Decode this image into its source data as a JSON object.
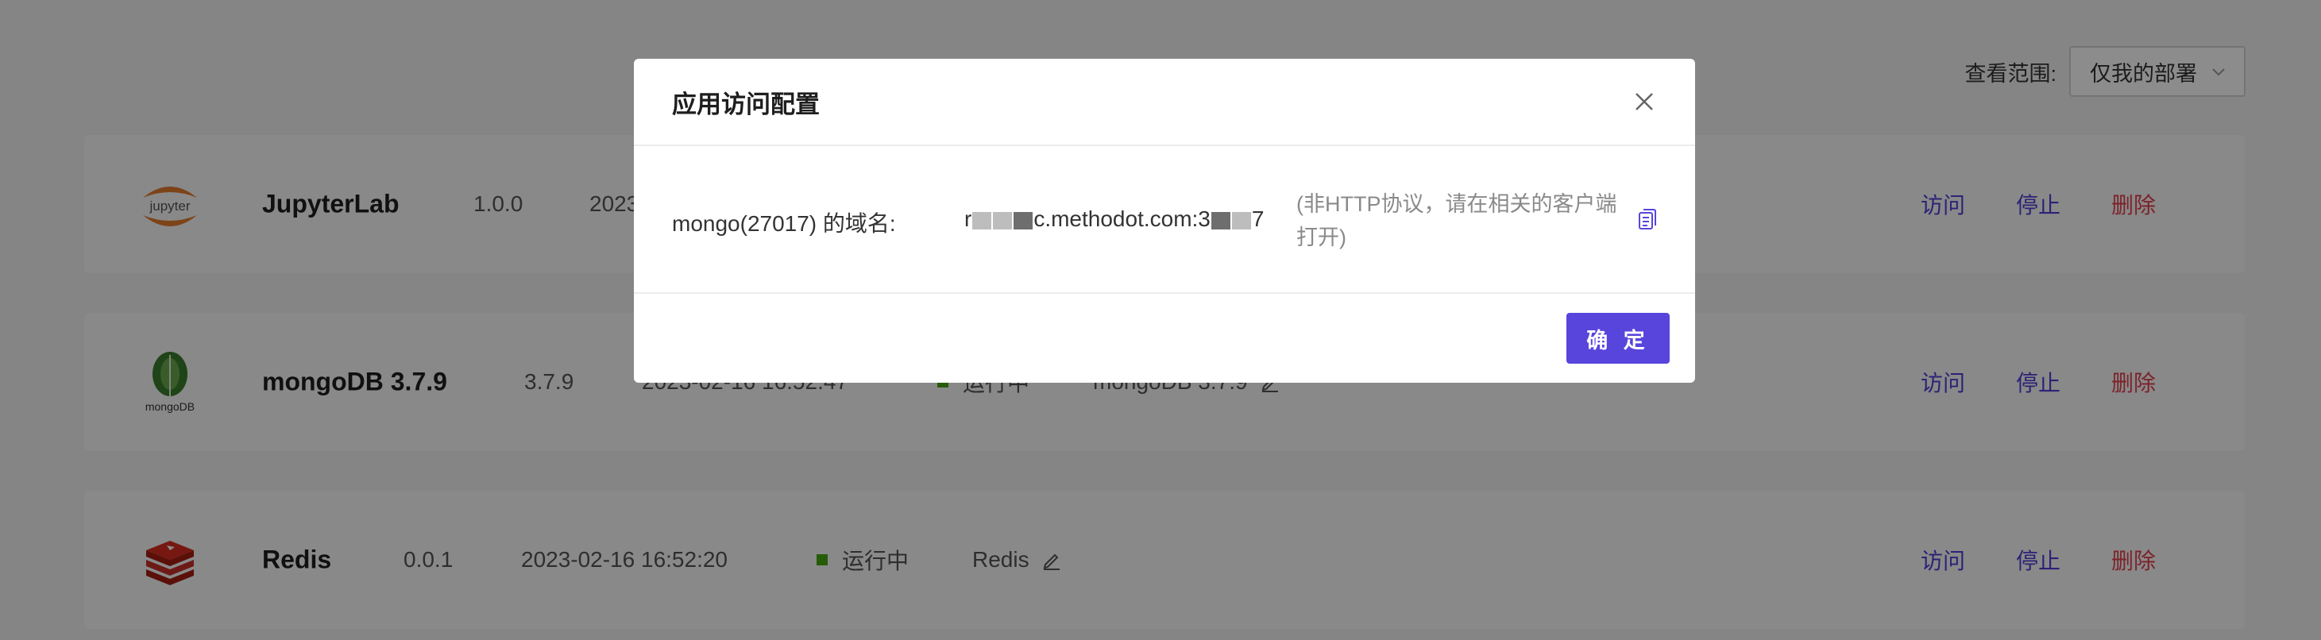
{
  "scope": {
    "label": "查看范围:",
    "value": "仅我的部署"
  },
  "apps": [
    {
      "logo_icon": "jupyter-logo",
      "logo_text": "jupyter",
      "name": "JupyterLab",
      "version": "1.0.0",
      "time": "2023",
      "actions": {
        "visit": "访问",
        "stop": "停止",
        "delete": "删除"
      }
    },
    {
      "logo_icon": "mongodb-logo",
      "logo_text": "mongoDB",
      "name": "mongoDB 3.7.9",
      "version": "3.7.9",
      "time": "2023-02-16 16:52:47",
      "status": "运行中",
      "alias": "mongoDB 3.7.9",
      "actions": {
        "visit": "访问",
        "stop": "停止",
        "delete": "删除"
      }
    },
    {
      "logo_icon": "redis-logo",
      "name": "Redis",
      "version": "0.0.1",
      "time": "2023-02-16 16:52:20",
      "status": "运行中",
      "alias": "Redis",
      "actions": {
        "visit": "访问",
        "stop": "停止",
        "delete": "删除"
      }
    }
  ],
  "modal": {
    "title": "应用访问配置",
    "row_label": "mongo(27017) 的域名:",
    "row_value_prefix": "r",
    "row_value_mid": "c.methodot.com:3",
    "row_value_suffix": "7",
    "note": "(非HTTP协议，请在相关的客户端打开)",
    "ok_label": "确 定"
  },
  "colors": {
    "primary": "#5845dc",
    "link": "#4f3fd6",
    "danger": "#e2414d",
    "running": "#46a80f"
  }
}
